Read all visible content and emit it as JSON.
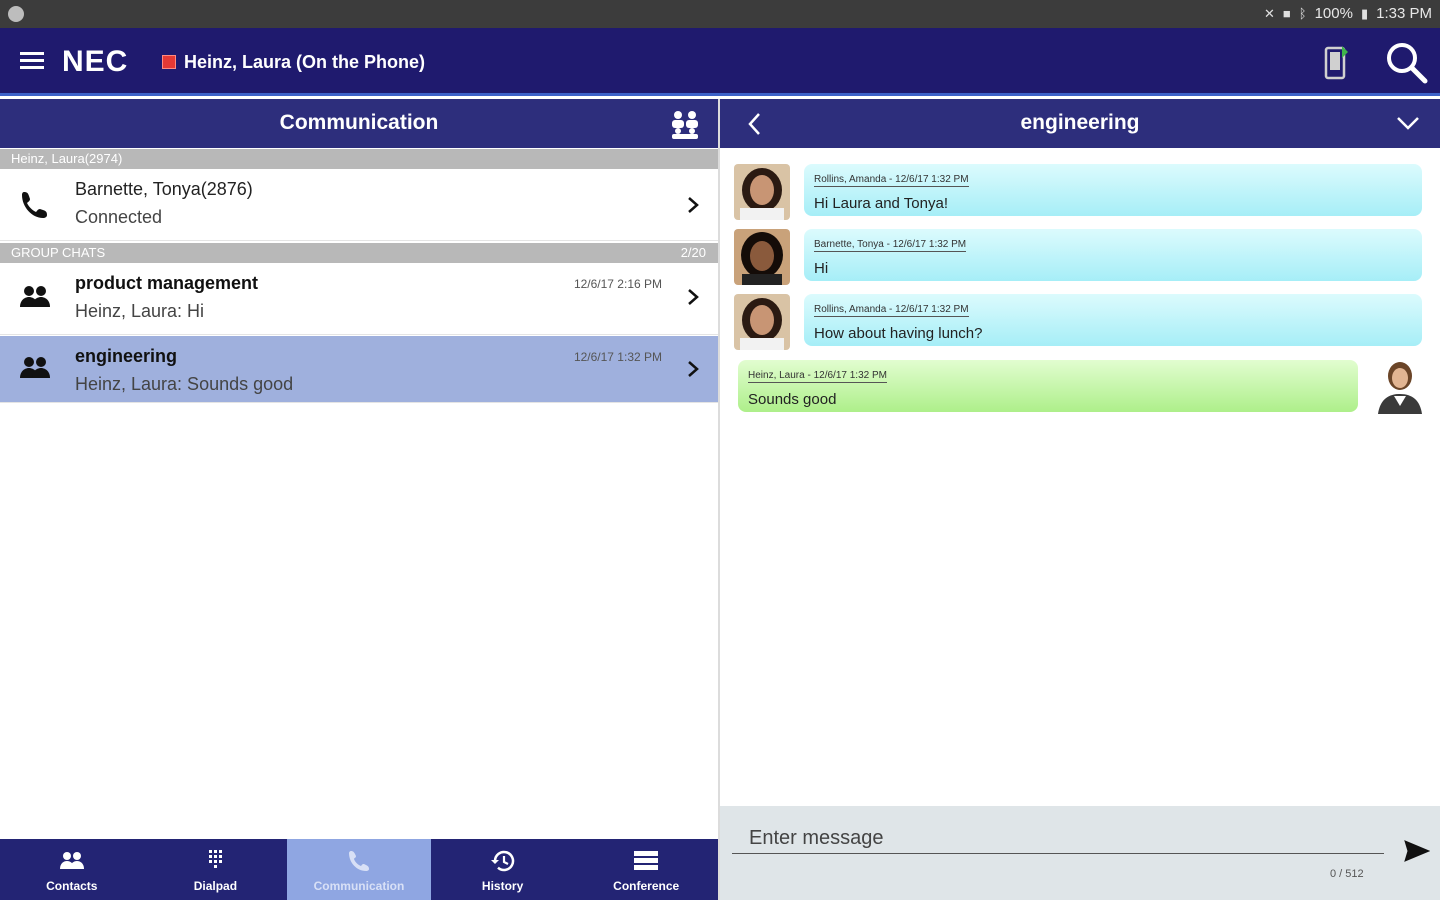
{
  "statusbar": {
    "battery": "100%",
    "time": "1:33 PM"
  },
  "appbar": {
    "logo": "NEC",
    "user_status": "Heinz, Laura (On the Phone)",
    "status_color": "#e53935"
  },
  "left_panel": {
    "title": "Communication",
    "call_section": {
      "header": "Heinz, Laura(2974)",
      "call": {
        "name": "Barnette, Tonya(2876)",
        "state": "Connected"
      }
    },
    "group_section": {
      "header": "GROUP CHATS",
      "count": "2/20",
      "items": [
        {
          "name": "product management",
          "last_message": "Heinz, Laura: Hi",
          "time": "12/6/17 2:16 PM",
          "selected": false
        },
        {
          "name": "engineering",
          "last_message": "Heinz, Laura: Sounds good",
          "time": "12/6/17 1:32 PM",
          "selected": true
        }
      ]
    }
  },
  "tabs": [
    {
      "label": "Contacts",
      "icon": "contacts-icon",
      "active": false
    },
    {
      "label": "Dialpad",
      "icon": "dialpad-icon",
      "active": false
    },
    {
      "label": "Communication",
      "icon": "phone-icon",
      "active": true
    },
    {
      "label": "History",
      "icon": "history-icon",
      "active": false
    },
    {
      "label": "Conference",
      "icon": "conference-icon",
      "active": false
    }
  ],
  "chat": {
    "title": "engineering",
    "messages": [
      {
        "meta": "Rollins, Amanda - 12/6/17 1:32 PM",
        "text": "Hi Laura and Tonya!",
        "direction": "in"
      },
      {
        "meta": "Barnette, Tonya - 12/6/17 1:32 PM",
        "text": "Hi",
        "direction": "in"
      },
      {
        "meta": "Rollins, Amanda - 12/6/17 1:32 PM",
        "text": "How about having lunch?",
        "direction": "in"
      },
      {
        "meta": "Heinz, Laura - 12/6/17 1:32 PM",
        "text": "Sounds good",
        "direction": "out"
      }
    ],
    "composer": {
      "placeholder": "Enter message",
      "char_count": "0 / 512"
    }
  },
  "colors": {
    "appbar": "#1f1a6e",
    "header": "#2d2e7c",
    "selected_row": "#9fb0dd",
    "active_tab": "#8fa6e2",
    "incoming_bubble": "#a6eef7",
    "outgoing_bubble": "#aeef8a"
  }
}
